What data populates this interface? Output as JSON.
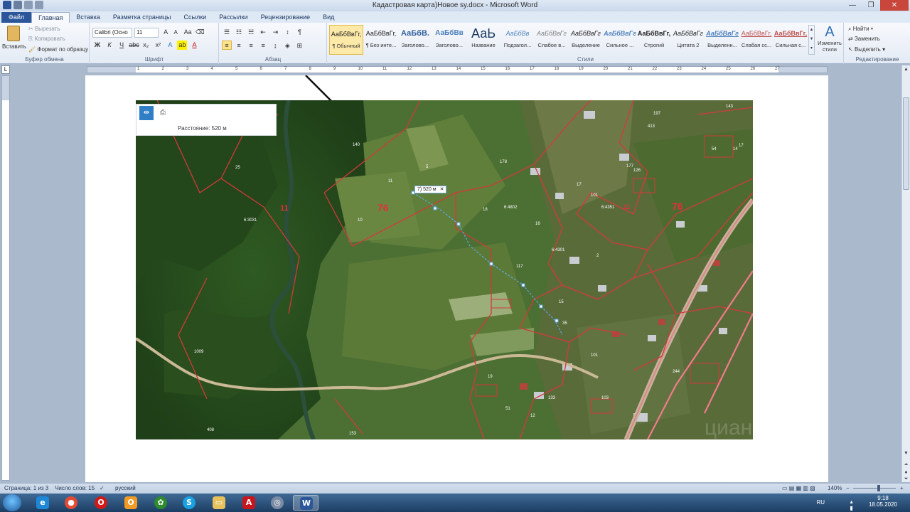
{
  "window": {
    "title": "Кадастровая карта)Новое sy.docx - Microsoft Word"
  },
  "tabs": [
    {
      "label": "Файл"
    },
    {
      "label": "Главная"
    },
    {
      "label": "Вставка"
    },
    {
      "label": "Разметка страницы"
    },
    {
      "label": "Ссылки"
    },
    {
      "label": "Рассылки"
    },
    {
      "label": "Рецензирование"
    },
    {
      "label": "Вид"
    }
  ],
  "ribbon": {
    "clipboard": {
      "paste": "Вставить",
      "cut": "Вырезать",
      "copy": "Копировать",
      "format_painter": "Формат по образцу",
      "group": "Буфер обмена"
    },
    "font": {
      "font_name": "Calibri (Осно",
      "font_size": "11",
      "group": "Шрифт"
    },
    "paragraph": {
      "group": "Абзац"
    },
    "styles": {
      "group": "Стили",
      "items": [
        {
          "preview": "АаБбВвГг,",
          "name": "¶ Обычный",
          "color": "#1e1e1e"
        },
        {
          "preview": "АаБбВвГг,",
          "name": "¶ Без инте...",
          "color": "#1e1e1e"
        },
        {
          "preview": "АаБбВ.",
          "name": "Заголово...",
          "color": "#2e5c9a"
        },
        {
          "preview": "АаБбВв",
          "name": "Заголово...",
          "color": "#4f81bd"
        },
        {
          "preview": "АаЬ",
          "name": "Название",
          "color": "#17365d"
        },
        {
          "preview": "АаБбВв",
          "name": "Подзагол...",
          "color": "#4f81bd"
        },
        {
          "preview": "АаБбВвГг",
          "name": "Слабое в...",
          "color": "#808080"
        },
        {
          "preview": "АаБбВвГг",
          "name": "Выделение",
          "color": "#1e1e1e"
        },
        {
          "preview": "АаБбВвГг",
          "name": "Сильное ...",
          "color": "#4f81bd"
        },
        {
          "preview": "АаБбВвГг,",
          "name": "Строгий",
          "color": "#1e1e1e"
        },
        {
          "preview": "АаБбВвГг",
          "name": "Цитата 2",
          "color": "#1e1e1e"
        },
        {
          "preview": "АаБбВвГг",
          "name": "Выделенн...",
          "color": "#4f81bd"
        },
        {
          "preview": "АаБбВвГг,",
          "name": "Слабая сс...",
          "color": "#c0504d"
        },
        {
          "preview": "АаБбВвГг,",
          "name": "Сильная с...",
          "color": "#c0504d"
        }
      ],
      "change_styles": "Изменить стили"
    },
    "editing": {
      "find": "Найти",
      "replace": "Заменить",
      "select": "Выделить",
      "group": "Редактирование"
    }
  },
  "ruler_marks": [
    "1",
    "2",
    "3",
    "4",
    "5",
    "6",
    "7",
    "8",
    "9",
    "10",
    "11",
    "12",
    "13",
    "14",
    "15",
    "16",
    "17",
    "18",
    "19",
    "20",
    "21",
    "22",
    "23",
    "24",
    "25",
    "26",
    "27"
  ],
  "map": {
    "distance_label": "Расстояние: 520 м",
    "measure_tag": "7) 520 м",
    "parcel_76_left": "76",
    "parcel_76_right": "76",
    "parcel_11_left": "11",
    "parcel_11_right": "11",
    "quarter_labels": [
      "6:3031",
      "6:4802",
      "6:4301",
      "6:4351"
    ],
    "plot_numbers": [
      "15",
      "16",
      "19",
      "113",
      "112",
      "82",
      "101",
      "244",
      "153",
      "143",
      "133",
      "177"
    ]
  },
  "status": {
    "page": "Страница: 1 из 3",
    "words": "Число слов: 15",
    "language": "русский",
    "zoom": "140%"
  },
  "taskbar": {
    "lang": "RU",
    "time": "9:18",
    "date": "18.05.2020"
  }
}
